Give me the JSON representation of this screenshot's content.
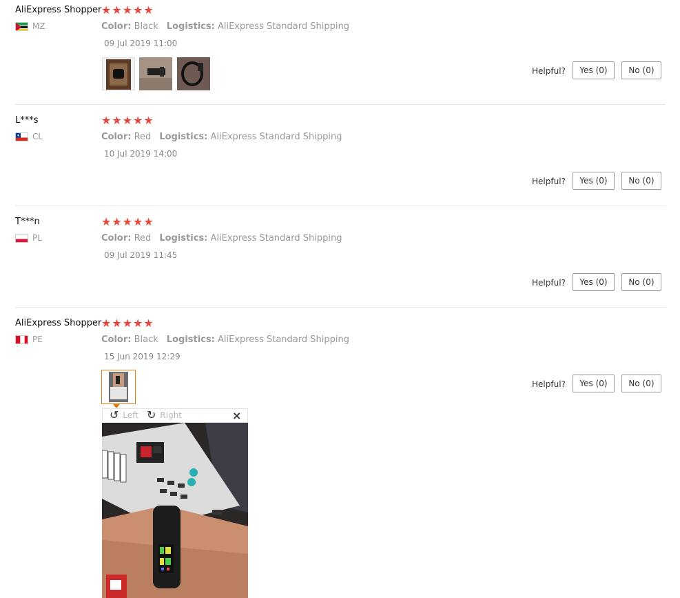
{
  "helpful_label": "Helpful?",
  "viewer": {
    "rotate_left": "Left",
    "rotate_right": "Right",
    "close": "×"
  },
  "reviews": [
    {
      "name": "AliExpress Shopper",
      "country": "MZ",
      "stars": "★★★★★",
      "color_label": "Color:",
      "color": "Black",
      "logistics_label": "Logistics:",
      "logistics": "AliExpress Standard Shipping",
      "date": "09 Jul 2019 11:00",
      "yes": "Yes (0)",
      "no": "No (0)"
    },
    {
      "name": "L***s",
      "country": "CL",
      "stars": "★★★★★",
      "color_label": "Color:",
      "color": "Red",
      "logistics_label": "Logistics:",
      "logistics": "AliExpress Standard Shipping",
      "date": "10 Jul 2019 14:00",
      "yes": "Yes (0)",
      "no": "No (0)"
    },
    {
      "name": "T***n",
      "country": "PL",
      "stars": "★★★★★",
      "color_label": "Color:",
      "color": "Red",
      "logistics_label": "Logistics:",
      "logistics": "AliExpress Standard Shipping",
      "date": "09 Jul 2019 11:45",
      "yes": "Yes (0)",
      "no": "No (0)"
    },
    {
      "name": "AliExpress Shopper",
      "country": "PE",
      "stars": "★★★★★",
      "color_label": "Color:",
      "color": "Black",
      "logistics_label": "Logistics:",
      "logistics": "AliExpress Standard Shipping",
      "date": "15 Jun 2019 12:29",
      "yes": "Yes (0)",
      "no": "No (0)"
    }
  ]
}
